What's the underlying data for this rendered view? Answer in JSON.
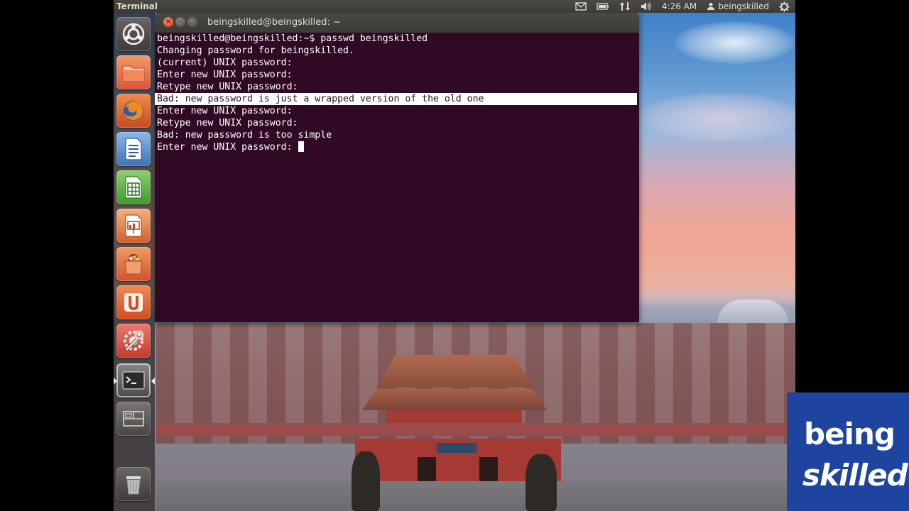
{
  "panel": {
    "app_title": "Terminal",
    "clock": "4:26 AM",
    "user": "beingskilled"
  },
  "window": {
    "title": "beingskilled@beingskilled: ~"
  },
  "terminal": {
    "lines": [
      "beingskilled@beingskilled:~$ passwd beingskilled",
      "Changing password for beingskilled.",
      "(current) UNIX password:",
      "Enter new UNIX password:",
      "Retype new UNIX password:",
      "Bad: new password is just a wrapped version of the old one",
      "Enter new UNIX password:",
      "Retype new UNIX password:",
      "Bad: new password is too simple",
      "Enter new UNIX password: "
    ],
    "selected_line_index": 5,
    "background": "#300a24",
    "foreground": "#ffffff"
  },
  "launcher": {
    "items": [
      {
        "name": "dash-home",
        "icon": "ubuntu-logo-icon"
      },
      {
        "name": "files",
        "icon": "folder-icon"
      },
      {
        "name": "firefox",
        "icon": "firefox-icon"
      },
      {
        "name": "libreoffice-writer",
        "icon": "writer-icon"
      },
      {
        "name": "libreoffice-calc",
        "icon": "calc-icon"
      },
      {
        "name": "libreoffice-impress",
        "icon": "impress-icon"
      },
      {
        "name": "ubuntu-software-center",
        "icon": "shopping-bag-icon"
      },
      {
        "name": "ubuntu-one",
        "icon": "ubuntu-one-icon"
      },
      {
        "name": "system-settings",
        "icon": "settings-wrench-icon"
      },
      {
        "name": "terminal",
        "icon": "terminal-icon",
        "active": true
      },
      {
        "name": "workspace-switcher",
        "icon": "workspaces-icon"
      },
      {
        "name": "trash",
        "icon": "trash-icon"
      }
    ]
  },
  "branding": {
    "line1": "being",
    "line2": "skilled",
    "color": "#1f44a0"
  }
}
